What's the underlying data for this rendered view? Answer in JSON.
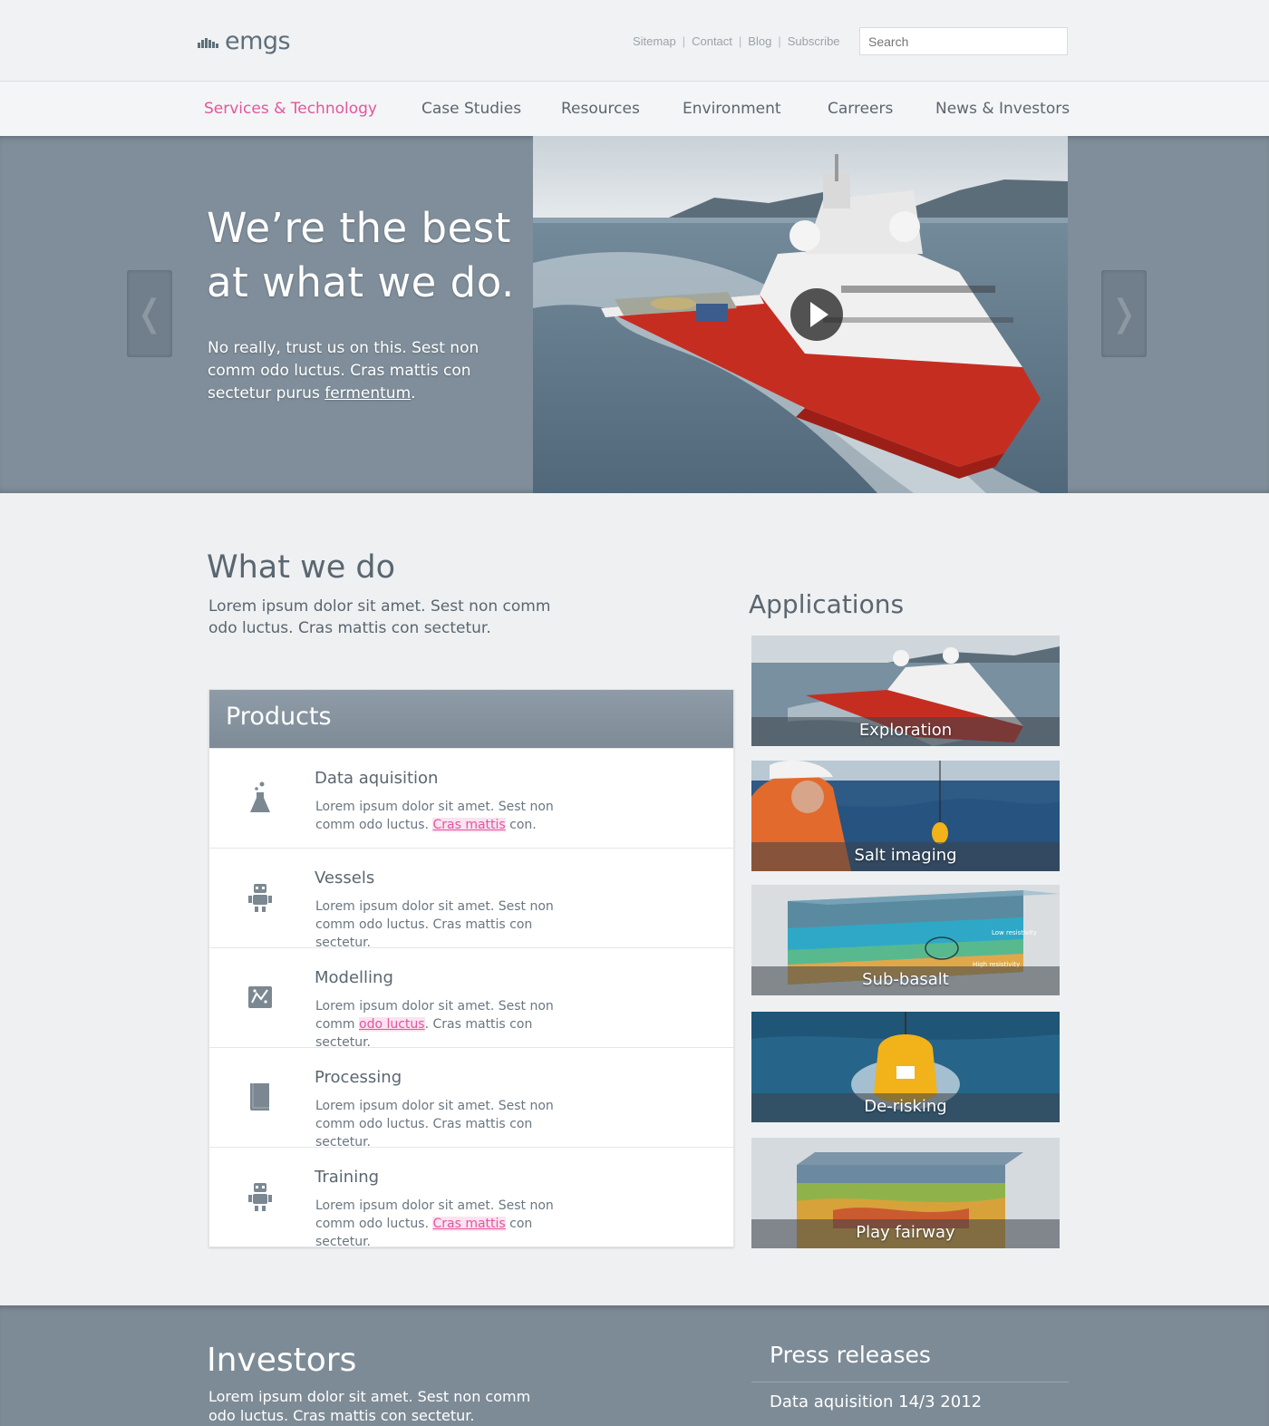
{
  "header": {
    "logo": "emgs",
    "utility_links": [
      "Sitemap",
      "Contact",
      "Blog",
      "Subscribe"
    ],
    "search_placeholder": "Search"
  },
  "nav": {
    "items": [
      {
        "label": "Services & Technology",
        "active": true
      },
      {
        "label": "Case Studies"
      },
      {
        "label": "Resources"
      },
      {
        "label": "Environment"
      },
      {
        "label": "Carreers"
      },
      {
        "label": "News & Investors"
      }
    ]
  },
  "hero": {
    "title": "We’re the best at what we do.",
    "text_before": "No really, trust us on this. Sest non comm odo luctus. Cras mattis con sectetur purus ",
    "link": "fermentum",
    "text_after": ".",
    "media": "ship-video",
    "prev_arrow": "❬",
    "next_arrow": "❭"
  },
  "what_we_do": {
    "title": "What we do",
    "text": "Lorem ipsum dolor sit amet. Sest non comm odo luctus. Cras mattis con sectetur."
  },
  "products": {
    "title": "Products",
    "items": [
      {
        "name": "Data aquisition",
        "icon": "flask-icon",
        "desc_a": "Lorem ipsum dolor sit amet. Sest non comm odo luctus. ",
        "desc_hl": "Cras mattis",
        "desc_b": " con."
      },
      {
        "name": "Vessels",
        "icon": "robot-icon",
        "desc_a": "Lorem ipsum dolor sit amet. Sest non comm odo luctus. Cras mattis con sectetur.",
        "desc_hl": "",
        "desc_b": ""
      },
      {
        "name": "Modelling",
        "icon": "chart-icon",
        "desc_a": "Lorem ipsum dolor sit amet. Sest non comm ",
        "desc_hl": "odo luctus",
        "desc_b": ". Cras mattis con sectetur."
      },
      {
        "name": "Processing",
        "icon": "book-icon",
        "desc_a": "Lorem ipsum dolor sit amet. Sest non comm odo luctus. Cras mattis con sectetur.",
        "desc_hl": "",
        "desc_b": ""
      },
      {
        "name": "Training",
        "icon": "robot-icon",
        "desc_a": "Lorem ipsum dolor sit amet. Sest non comm odo luctus. ",
        "desc_hl": "Cras mattis",
        "desc_b": " con sectetur."
      }
    ]
  },
  "applications": {
    "title": "Applications",
    "items": [
      "Exploration",
      "Salt imaging",
      "Sub-basalt",
      "De-risking",
      "Play fairway"
    ],
    "image_labels": [
      "Low resistivity",
      "High resistivity"
    ]
  },
  "investors": {
    "title": "Investors",
    "text": "Lorem ipsum dolor sit amet. Sest non comm odo luctus. Cras mattis con sectetur.",
    "press_title": "Press releases",
    "press_item": "Data aquisition 14/3 2012"
  },
  "colors": {
    "accent": "#e2569f",
    "hero_bg": "#7f8e9a",
    "text": "#5a6670"
  }
}
